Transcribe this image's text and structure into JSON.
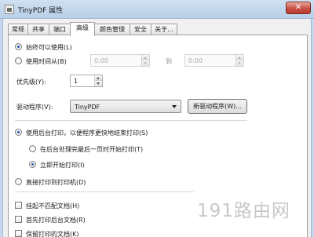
{
  "window": {
    "title": "TinyPDF 属性",
    "close_glyph": "✕",
    "app_icon": "printer-icon"
  },
  "tabs": [
    {
      "label": "常规",
      "active": false
    },
    {
      "label": "共享",
      "active": false
    },
    {
      "label": "端口",
      "active": false
    },
    {
      "label": "高级",
      "active": true
    },
    {
      "label": "颜色管理",
      "active": false
    },
    {
      "label": "安全",
      "active": false
    },
    {
      "label": "关于...",
      "active": false
    }
  ],
  "availability": {
    "always_label": "始终可以使用(L)",
    "always_selected": true,
    "time_label": "使用时间从(B)",
    "time_selected": false,
    "from_value": "0:00",
    "to_label": "到",
    "to_value": "0:00"
  },
  "priority": {
    "label": "优先级(Y):",
    "value": "1"
  },
  "driver": {
    "label": "驱动程序(V):",
    "value": "TinyPDF",
    "new_driver_button": "新驱动程序(W)..."
  },
  "spool": {
    "spool_label": "使用后台打印，以便程序更快地结束打印(S)",
    "spool_selected": true,
    "after_last_page_label": "在后台处理完最后一页时开始打印(T)",
    "after_last_page_selected": false,
    "immediately_label": "立即开始打印(I)",
    "immediately_selected": true,
    "direct_label": "直接打印到打印机(D)",
    "direct_selected": false
  },
  "options": [
    {
      "label": "挂起不匹配文档(H)",
      "checked": false
    },
    {
      "label": "首先打印后台文档(R)",
      "checked": false
    },
    {
      "label": "保留打印的文档(K)",
      "checked": false
    }
  ],
  "watermark": {
    "text": "191路由网"
  }
}
